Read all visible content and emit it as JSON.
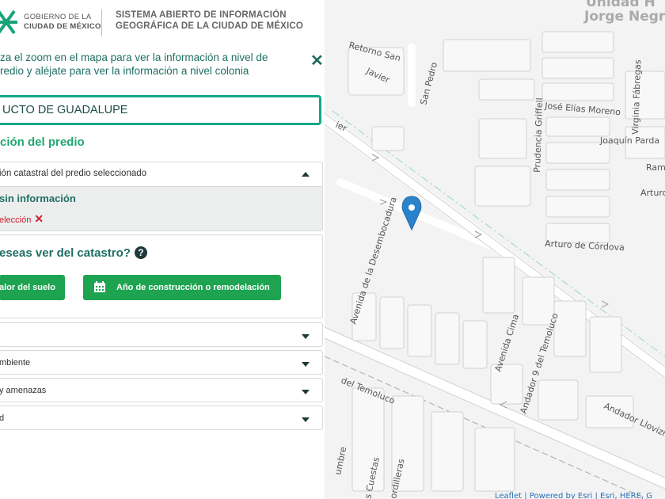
{
  "header": {
    "gov_line1": "GOBIERNO DE LA",
    "gov_line2": "CIUDAD DE MÉXICO",
    "system_line1": "SISTEMA ABIERTO DE INFORMACIÓN",
    "system_line2": "GEOGRÁFICA DE LA CIUDAD DE MÉXICO",
    "brand_color": "#17a47a"
  },
  "panel": {
    "hint_line1": "za el zoom en el mapa para ver la información a nivel de",
    "hint_line2": "redio y aléjate para ver la información a nivel colonia",
    "search_value": "UCTO DE GUADALUPE",
    "section_title": "ción del predio",
    "cadastral_card": {
      "header": "ión catastral del predio seleccionado",
      "no_info": "sin información",
      "deselect": "elección"
    },
    "catastro_card": {
      "question": "eseas ver del catastro?",
      "btn_value": "alor del suelo",
      "btn_year": "Año de construcción o remodelación"
    },
    "accordions": [
      {
        "label": ""
      },
      {
        "label": "mbiente"
      },
      {
        "label": "y amenazas"
      },
      {
        "label": "d"
      }
    ]
  },
  "map": {
    "labels": {
      "top_right_1": "Jorge Negre",
      "top_right_0": "Unidad H",
      "retorno_san": "Retorno San",
      "javier": "Javier",
      "san_pedro": "San Pedro",
      "jose_elias": "José Elías Moreno",
      "virginia": "Virginia Fábregas",
      "prudencia": "Prudencia Griffell",
      "joaquin": "Joaquín Parda",
      "ram": "Ram",
      "arturo": "Arturo",
      "arturo_cordova": "Arturo de Córdova",
      "avenida_desemboc": "Avenida de la Desembocadura",
      "avenida_cima": "Avenida Cima",
      "andador_9": "Andador 9 del Temoluco",
      "andador_lloviz": "Andador Llovizna",
      "del_temoluco": "del Temoluco",
      "cuestas": "s Cuestas",
      "ordilleras": "ordilleras",
      "cumbre": "umbre",
      "ier": "ier",
      "attribution": "Leaflet | Powered by Esri | Esri, HERE, G"
    }
  }
}
